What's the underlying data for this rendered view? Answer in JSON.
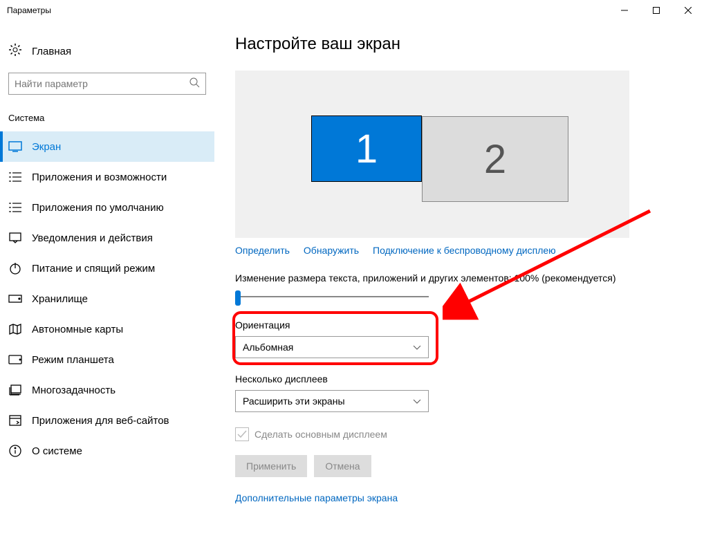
{
  "window_title": "Параметры",
  "sidebar": {
    "home_label": "Главная",
    "search_placeholder": "Найти параметр",
    "section_label": "Система",
    "items": [
      {
        "icon": "display",
        "label": "Экран",
        "selected": true
      },
      {
        "icon": "apps",
        "label": "Приложения и возможности"
      },
      {
        "icon": "defaults",
        "label": "Приложения по умолчанию"
      },
      {
        "icon": "notifications",
        "label": "Уведомления и действия"
      },
      {
        "icon": "power",
        "label": "Питание и спящий режим"
      },
      {
        "icon": "storage",
        "label": "Хранилище"
      },
      {
        "icon": "maps",
        "label": "Автономные карты"
      },
      {
        "icon": "tablet",
        "label": "Режим планшета"
      },
      {
        "icon": "multitask",
        "label": "Многозадачность"
      },
      {
        "icon": "webapps",
        "label": "Приложения для веб-сайтов"
      },
      {
        "icon": "about",
        "label": "О системе"
      }
    ]
  },
  "main": {
    "page_title": "Настройте ваш экран",
    "monitors": [
      {
        "num": "1",
        "primary": true
      },
      {
        "num": "2",
        "primary": false
      }
    ],
    "links": {
      "identify": "Определить",
      "detect": "Обнаружить",
      "wireless": "Подключение к беспроводному дисплею"
    },
    "scale_label": "Изменение размера текста, приложений и других элементов: 100% (рекомендуется)",
    "orientation_label": "Ориентация",
    "orientation_value": "Альбомная",
    "multiple_label": "Несколько дисплеев",
    "multiple_value": "Расширить эти экраны",
    "make_main_label": "Сделать основным дисплеем",
    "apply_label": "Применить",
    "cancel_label": "Отмена",
    "advanced_link": "Дополнительные параметры экрана"
  }
}
